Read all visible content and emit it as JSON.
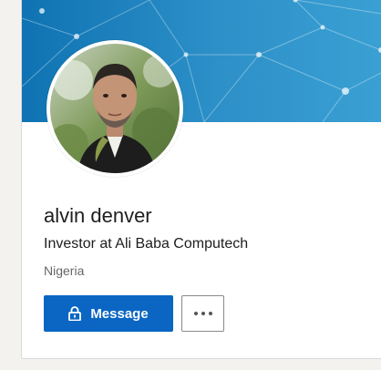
{
  "profile": {
    "name": "alvin denver",
    "headline": "Investor at Ali Baba Computech",
    "location": "Nigeria"
  },
  "actions": {
    "message_label": "Message",
    "message_icon": "lock-icon",
    "more_icon": "more-horizontal-icon"
  },
  "colors": {
    "banner": "#1b82c0",
    "primary_button": "#0a66c2"
  }
}
